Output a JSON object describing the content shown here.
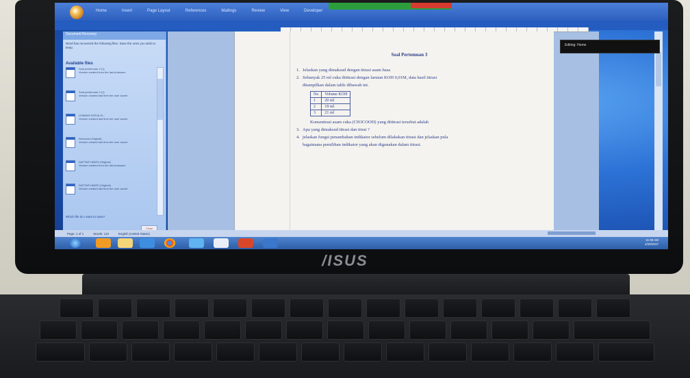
{
  "word": {
    "tabs": [
      "Home",
      "Insert",
      "Page Layout",
      "References",
      "Mailings",
      "Review",
      "View",
      "Developer"
    ],
    "pane": {
      "header": "Document Recovery",
      "intro": "Word has recovered the following files. Save the ones you wish to keep.",
      "available_label": "Available files",
      "items": [
        {
          "title": "Soal pertemuan 3 (1)",
          "desc": "Version created from the last Autosave"
        },
        {
          "title": "Soal pertemuan 3 (1)",
          "desc": "Version created last time the user saved"
        },
        {
          "title": "LEMBAR KERJA SI...",
          "desc": "Version created last time the user saved"
        },
        {
          "title": "Rencana (Original)",
          "desc": "Version created last time the user saved"
        },
        {
          "title": "DAFTAR HADIR (Original)",
          "desc": "Version created from the last Autosave"
        },
        {
          "title": "DAFTAR HADIR (Original)",
          "desc": "Version created last time the user saved"
        }
      ],
      "help_link": "Which file do I want to save?",
      "close_button": "Close"
    },
    "document": {
      "title": "Soal Pertemuan 3",
      "questions": [
        {
          "num": "1.",
          "text": "Jelaskan yang dimaksud dengan titrasi asam basa"
        },
        {
          "num": "2.",
          "text": "Sebanyak 25 ml cuka dititrasi dengan larutan KOH 0,01M, data hasil titrasi"
        },
        {
          "num": "",
          "text": "ditampilkan dalam table dibawah ini."
        }
      ],
      "table": {
        "headers": [
          "No",
          "Volume KOH"
        ],
        "rows": [
          [
            "1",
            "20 ml"
          ],
          [
            "2",
            "19 ml"
          ],
          [
            "3",
            "21 ml"
          ]
        ]
      },
      "after_table": "Konsentrasi asam cuka (CH3COOH) yang dititrasi tersebut adalah",
      "questions_more": [
        {
          "num": "3.",
          "text": "Apa yang dimaksud titrasi dan titrat ?"
        },
        {
          "num": "4.",
          "text": "jelaskan fungsi penambahan indikator sebelum dilakukan titrasi dan jelaskan pula"
        },
        {
          "num": "",
          "text": "bagaimana pemilihan indikator yang akan digunakan dalam titrasi."
        }
      ]
    },
    "floating_label": "Editing: Home",
    "status": [
      "Page: 1 of 1",
      "Words: 113",
      "English (United States)"
    ],
    "clock": {
      "time": "11:08 AM",
      "date": "4/26/2017"
    }
  },
  "brand": "/ISUS",
  "colors": {
    "page_text": "#2e3d8a",
    "ribbon": "#2e5fbf",
    "wallpaper": "#1f62c9"
  }
}
